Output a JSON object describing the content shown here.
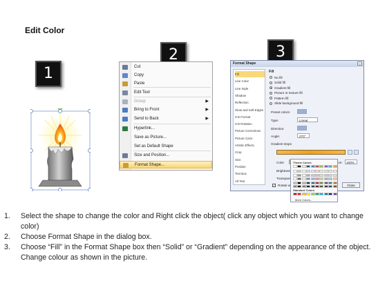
{
  "header": {
    "title": "Edit Color"
  },
  "steps_badges": [
    "1",
    "2",
    "3"
  ],
  "context_menu": {
    "items": [
      {
        "label": "Cut",
        "icon": "scissors-icon",
        "color": "#6a7a9a",
        "disabled": false,
        "arrow": false
      },
      {
        "label": "Copy",
        "icon": "copy-icon",
        "color": "#5f87c9",
        "disabled": false,
        "arrow": false
      },
      {
        "label": "Paste",
        "icon": "paste-icon",
        "color": "#c79a3a",
        "disabled": false,
        "arrow": false
      },
      {
        "label": "Edit Text",
        "icon": "edit-text-icon",
        "color": "#7b86a0",
        "disabled": false,
        "arrow": false
      },
      {
        "label": "Group",
        "icon": "group-icon",
        "color": "#aab0bd",
        "disabled": true,
        "arrow": true
      },
      {
        "label": "Bring to Front",
        "icon": "bring-front-icon",
        "color": "#4d7cc2",
        "disabled": false,
        "arrow": true
      },
      {
        "label": "Send to Back",
        "icon": "send-back-icon",
        "color": "#4d7cc2",
        "disabled": false,
        "arrow": true
      },
      {
        "label": "Hyperlink...",
        "icon": "hyperlink-icon",
        "color": "#2f7a3f",
        "disabled": false,
        "arrow": false
      },
      {
        "label": "Save as Picture...",
        "icon": "",
        "color": "",
        "disabled": false,
        "arrow": false
      },
      {
        "label": "Set as Default Shape",
        "icon": "",
        "color": "",
        "disabled": false,
        "arrow": false
      },
      {
        "label": "Size and Position...",
        "icon": "size-position-icon",
        "color": "#6b7b98",
        "disabled": false,
        "arrow": false
      },
      {
        "label": "Format Shape...",
        "icon": "format-shape-icon",
        "color": "#d29a2e",
        "disabled": false,
        "arrow": false
      }
    ]
  },
  "format_dialog": {
    "title": "Format Shape",
    "close_glyph": "?",
    "nav": [
      "Fill",
      "Line Color",
      "Line Style",
      "Shadow",
      "Reflection",
      "Glow and Soft Edges",
      "3-D Format",
      "3-D Rotation",
      "Picture Corrections",
      "Picture Color",
      "Artistic Effects",
      "Crop",
      "Size",
      "Position",
      "Text Box",
      "Alt Text"
    ],
    "section_title": "Fill",
    "fill_options": [
      "No fill",
      "Solid fill",
      "Gradient fill",
      "Picture or texture fill",
      "Pattern fill",
      "Slide background fill"
    ],
    "selected_option": 2,
    "fields": {
      "preset_colors": "Preset colors:",
      "type": "Type:",
      "type_value": "Linear",
      "direction": "Direction:",
      "angle": "Angle:",
      "angle_value": "270°",
      "gradient_stops": "Gradient stops",
      "color": "Color",
      "position": "Position:",
      "position_value": "100%",
      "brightness": "Brightness:",
      "transparency": "Transparency:",
      "rotate": "Rotate with shape"
    },
    "close_button": "Close"
  },
  "palette": {
    "theme_label": "Theme Colors",
    "standard_label": "Standard Colors",
    "more_label": "More Colors...",
    "theme_top": [
      "#ffffff",
      "#000000",
      "#eeece1",
      "#1f497d",
      "#4f81bd",
      "#c0504d",
      "#9bbb59",
      "#8064a2",
      "#4bacc6",
      "#f79646"
    ],
    "standard": [
      "#c00000",
      "#ff0000",
      "#ffc000",
      "#ffff00",
      "#92d050",
      "#00b050",
      "#00b0f0",
      "#0070c0",
      "#002060",
      "#7030a0"
    ]
  },
  "instructions": [
    {
      "num": "1.",
      "text": "Select the shape to change the color and Right click the object( click any object which you want to change color)"
    },
    {
      "num": "2.",
      "text": "Choose Format Shape in the dialog box."
    },
    {
      "num": "3.",
      "text": "Choose “Fill” in the Format Shape box then “Solid” or “Gradient” depending on the appearance of the object. Change colour as shown in the picture."
    }
  ]
}
